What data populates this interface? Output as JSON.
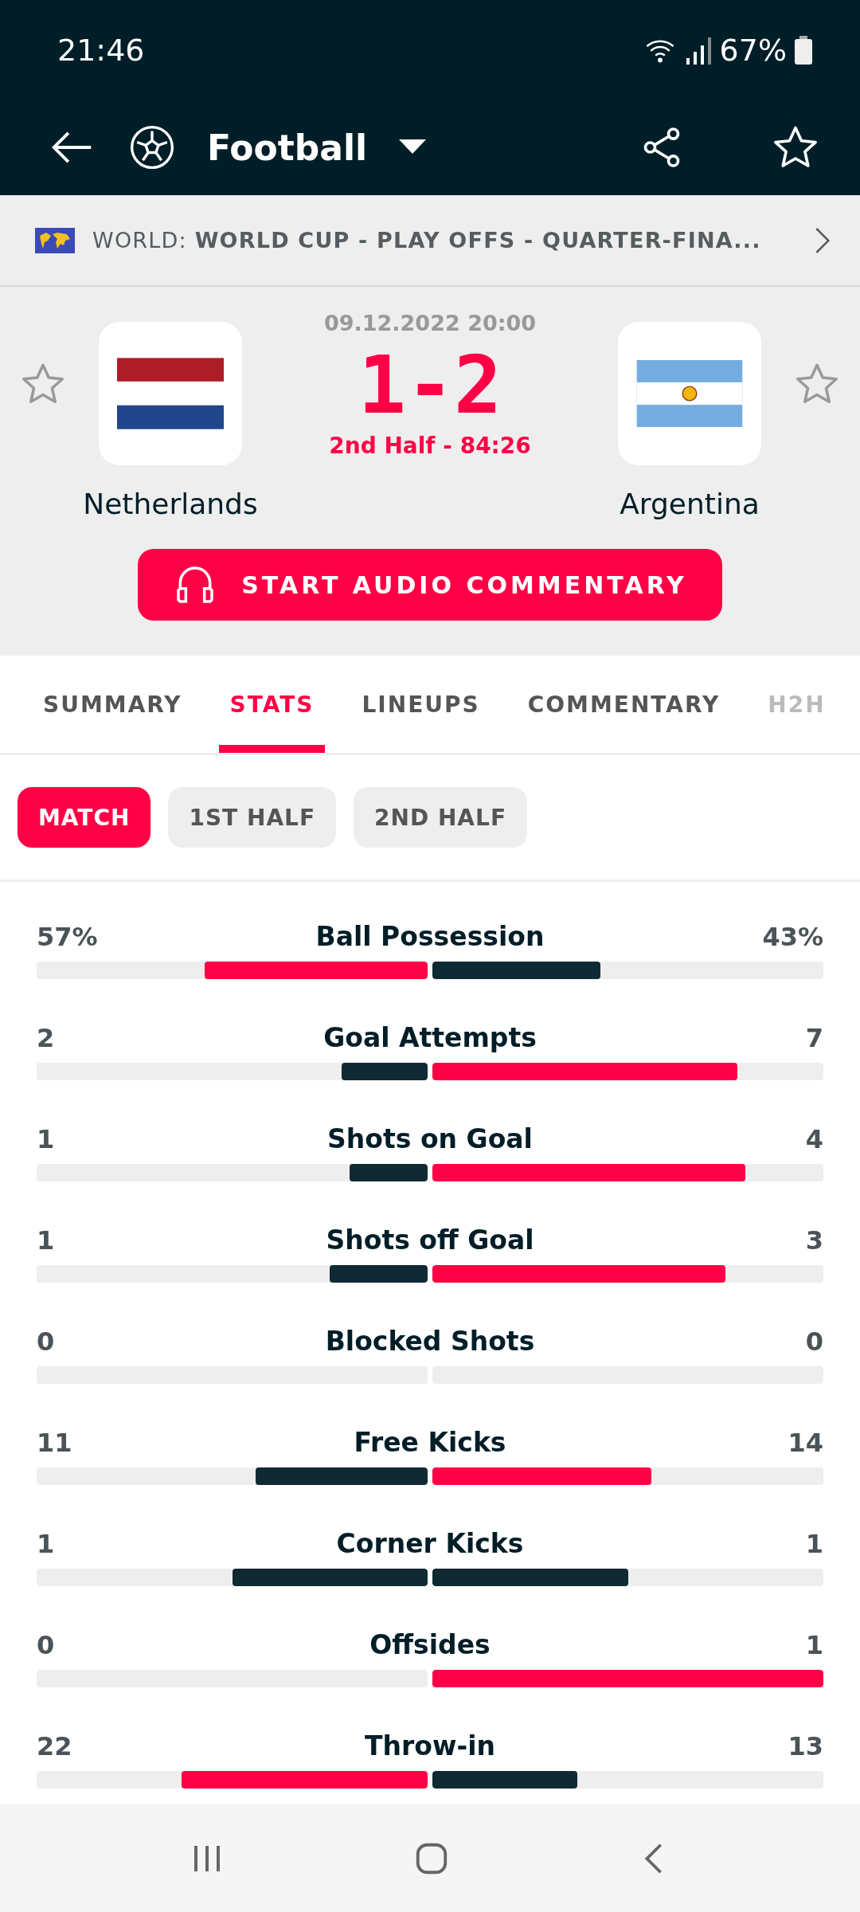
{
  "status_bar": {
    "time": "21:46",
    "battery": "67%"
  },
  "app_bar": {
    "title": "Football"
  },
  "competition": {
    "prefix": "WORLD:",
    "name": "WORLD CUP - PLAY OFFS - QUARTER-FINA..."
  },
  "match": {
    "date": "09.12.2022 20:00",
    "score": "1-2",
    "period": "2nd Half - 84:26",
    "home": {
      "name": "Netherlands"
    },
    "away": {
      "name": "Argentina"
    },
    "audio_button": "START AUDIO COMMENTARY"
  },
  "tabs": [
    {
      "label": "SUMMARY",
      "selected": false,
      "faded": false
    },
    {
      "label": "STATS",
      "selected": true,
      "faded": false
    },
    {
      "label": "LINEUPS",
      "selected": false,
      "faded": false
    },
    {
      "label": "COMMENTARY",
      "selected": false,
      "faded": false
    },
    {
      "label": "H2H",
      "selected": false,
      "faded": true
    }
  ],
  "periods": [
    {
      "label": "MATCH",
      "selected": true
    },
    {
      "label": "1ST HALF",
      "selected": false
    },
    {
      "label": "2ND HALF",
      "selected": false
    }
  ],
  "stats": [
    {
      "label": "Ball Possession",
      "home": {
        "value": "57%",
        "level": 0.57,
        "leading": true
      },
      "away": {
        "value": "43%",
        "level": 0.43,
        "leading": false
      }
    },
    {
      "label": "Goal Attempts",
      "home": {
        "value": "2",
        "level": 0.22,
        "leading": false
      },
      "away": {
        "value": "7",
        "level": 0.78,
        "leading": true
      }
    },
    {
      "label": "Shots on Goal",
      "home": {
        "value": "1",
        "level": 0.2,
        "leading": false
      },
      "away": {
        "value": "4",
        "level": 0.8,
        "leading": true
      }
    },
    {
      "label": "Shots off Goal",
      "home": {
        "value": "1",
        "level": 0.25,
        "leading": false
      },
      "away": {
        "value": "3",
        "level": 0.75,
        "leading": true
      }
    },
    {
      "label": "Blocked Shots",
      "home": {
        "value": "0"
      },
      "away": {
        "value": "0"
      }
    },
    {
      "label": "Free Kicks",
      "home": {
        "value": "11",
        "level": 0.44,
        "leading": false
      },
      "away": {
        "value": "14",
        "level": 0.56,
        "leading": true
      }
    },
    {
      "label": "Corner Kicks",
      "home": {
        "value": "1",
        "level": 0.5,
        "leading": false
      },
      "away": {
        "value": "1",
        "level": 0.5,
        "leading": false
      }
    },
    {
      "label": "Offsides",
      "home": {
        "value": "0"
      },
      "away": {
        "value": "1",
        "level": 1,
        "leading": true
      }
    },
    {
      "label": "Throw-in",
      "home": {
        "value": "22",
        "level": 0.63,
        "leading": true
      },
      "away": {
        "value": "13",
        "level": 0.37,
        "leading": false
      }
    }
  ]
}
